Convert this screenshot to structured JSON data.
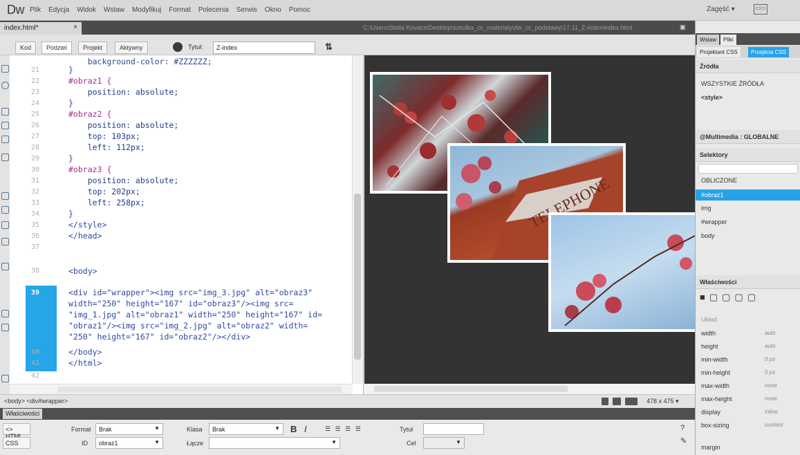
{
  "app": {
    "logo": "Dw",
    "menu": [
      "Plik",
      "Edycja",
      "Widok",
      "Wstaw",
      "Modyfikuj",
      "Format",
      "Polecenia",
      "Serwis",
      "Okno",
      "Pomoc"
    ],
    "workspace": "Zagęść ▾"
  },
  "document": {
    "tab": "index.html*",
    "tab_close": "×",
    "path": "C:\\Users\\Stella Kovacs\\Desktop\\szkolka_cc_materialy\\dw_cc_podstawy\\17.11_Z-index\\index.html"
  },
  "viewbar": {
    "buttons": [
      "Kod",
      "Podziel",
      "Projekt",
      "Aktywny"
    ],
    "title_label": "Tytuł:",
    "title_value": "Z-index",
    "sort_icon": "⇅"
  },
  "code": {
    "line_numbers": [
      "21",
      "22",
      "23",
      "24",
      "25",
      "26",
      "27",
      "28",
      "29",
      "30",
      "31",
      "32",
      "33",
      "34",
      "35",
      "36",
      "37",
      "38",
      "39",
      "",
      "",
      "",
      "",
      "40",
      "41",
      "42"
    ],
    "current_line": "39",
    "lines": {
      "l20": "    background-color: #ZZZZZZ;",
      "l21": "}",
      "l22": "#obraz1 {",
      "l23": "    position: absolute;",
      "l24": "}",
      "l25": "#obraz2 {",
      "l26": "    position: absolute;",
      "l27": "    top: 103px;",
      "l28": "    left: 112px;",
      "l29": "}",
      "l30": "#obraz3 {",
      "l31": "    position: absolute;",
      "l32": "    top: 202px;",
      "l33": "    left: 258px;",
      "l34": "}",
      "l35": "</style>",
      "l36": "</head>",
      "l37": "",
      "l38": "<body>",
      "l39a": "<div id=\"wrapper\"><img src=\"img_3.jpg\" alt=\"obraz3\"",
      "l39b": "width=\"250\" height=\"167\" id=\"obraz3\"/><img src=",
      "l39c": "\"img_1.jpg\" alt=\"obraz1\" width=\"250\" height=\"167\" id=",
      "l39d": "\"obraz1\"/><img src=\"img_2.jpg\" alt=\"obraz2\" width=",
      "l39e": "\"250\" height=\"167\" id=\"obraz2\"/></div>",
      "l40": "</body>",
      "l41": "</html>",
      "l42": ""
    }
  },
  "statusbar": {
    "tagpath": "<body> <div#wrapper>",
    "window_size": "478 x 475 ▾"
  },
  "properties": {
    "header": "Właściwości",
    "html_button": "<> HTML",
    "css_button": "CSS",
    "format_label": "Format",
    "format_value": "Brak",
    "class_label": "Klasa",
    "class_value": "Brak",
    "id_label": "ID",
    "id_value": "obraz1",
    "link_label": "Łącze",
    "bold": "B",
    "italic": "I",
    "title_label": "Tytuł",
    "target_label": "Cel"
  },
  "right": {
    "tabs_top": [
      "Wstaw",
      "Pliki"
    ],
    "tabs_css": [
      "Projektant CSS",
      "Przejścia CSS"
    ],
    "sources_header": "Źródła",
    "sources": [
      "WSZYSTKIE ŹRÓDŁA",
      "<style>"
    ],
    "media_header": "@Multimedia : GLOBALNE",
    "selectors_header": "Selektory",
    "selectors": [
      "OBLICZONE",
      "#obraz1",
      "img",
      "#wrapper",
      "body"
    ],
    "selected_selector": "#obraz1",
    "props_header": "Właściwości",
    "layout_label": "Układ",
    "props": [
      {
        "name": "width",
        "value": "auto"
      },
      {
        "name": "height",
        "value": "auto"
      },
      {
        "name": "min-width",
        "value": "0 px"
      },
      {
        "name": "min-height",
        "value": "0 px"
      },
      {
        "name": "max-width",
        "value": "none"
      },
      {
        "name": "max-height",
        "value": "none"
      },
      {
        "name": "display",
        "value": "inline"
      },
      {
        "name": "box-sizing",
        "value": "content"
      },
      {
        "name": "margin",
        "value": ""
      }
    ]
  },
  "colors": {
    "accent": "#28a2e6",
    "design_bg": "#333333",
    "photo_border": "#ffffff"
  }
}
